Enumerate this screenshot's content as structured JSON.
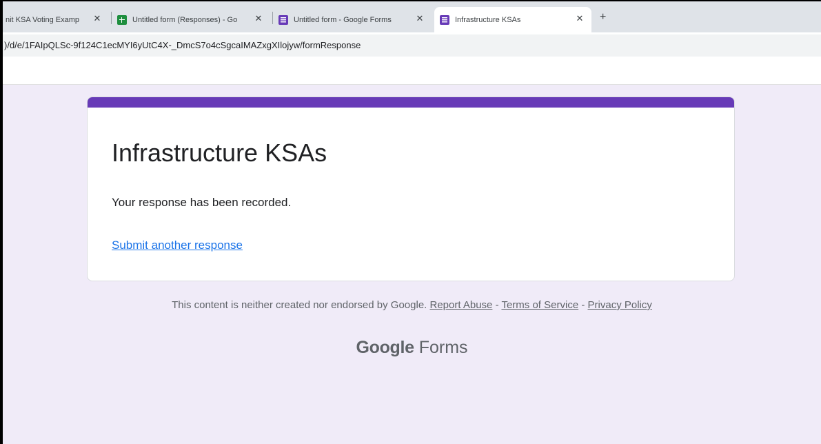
{
  "browser": {
    "tabs": [
      {
        "label": "nit KSA Voting Examp",
        "icon": "none",
        "active": false
      },
      {
        "label": "Untitled form (Responses) - Go",
        "icon": "sheets-icon",
        "active": false
      },
      {
        "label": "Untitled form - Google Forms",
        "icon": "forms-icon",
        "active": false
      },
      {
        "label": "Infrastructure KSAs",
        "icon": "forms-icon",
        "active": true
      }
    ],
    "close_glyph": "✕",
    "new_tab_glyph": "+",
    "address": ")/d/e/1FAIpQLSc-9f124C1ecMYI6yUtC4X-_DmcS7o4cSgcaIMAZxgXIlojyw/formResponse"
  },
  "form": {
    "title": "Infrastructure KSAs",
    "message": "Your response has been recorded.",
    "another_link": "Submit another response",
    "accent_color": "#673ab7"
  },
  "footer": {
    "disclaimer": "This content is neither created nor endorsed by Google.",
    "report_abuse": "Report Abuse",
    "sep1": " - ",
    "terms": "Terms of Service",
    "sep2": " - ",
    "privacy": "Privacy Policy",
    "brand_google": "Google",
    "brand_forms": "Forms"
  }
}
